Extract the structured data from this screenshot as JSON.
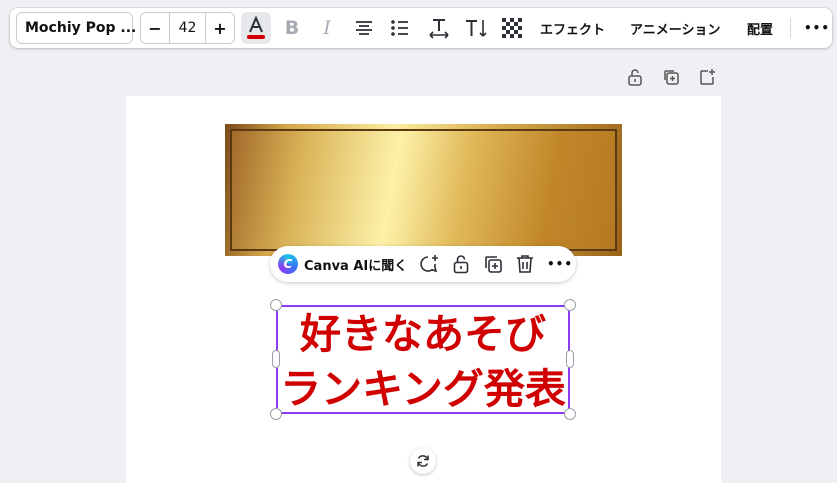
{
  "toolbar": {
    "font_name": "Mochiy Pop ...",
    "font_size": "42",
    "decrease_label": "−",
    "increase_label": "+",
    "effects_label": "エフェクト",
    "animation_label": "アニメーション",
    "position_label": "配置",
    "more_label": "•••",
    "text_color": "#d10000"
  },
  "floating_bar": {
    "ai_logo_letter": "C",
    "ask_ai_label": "Canva AIに聞く",
    "more_label": "•••"
  },
  "canvas": {
    "text_line1": "好きなあそび",
    "text_line2": "ランキング発表",
    "text_color": "#d10000",
    "selection_color": "#8b3cf0"
  },
  "icons": {
    "bold": "B",
    "italic": "I"
  }
}
